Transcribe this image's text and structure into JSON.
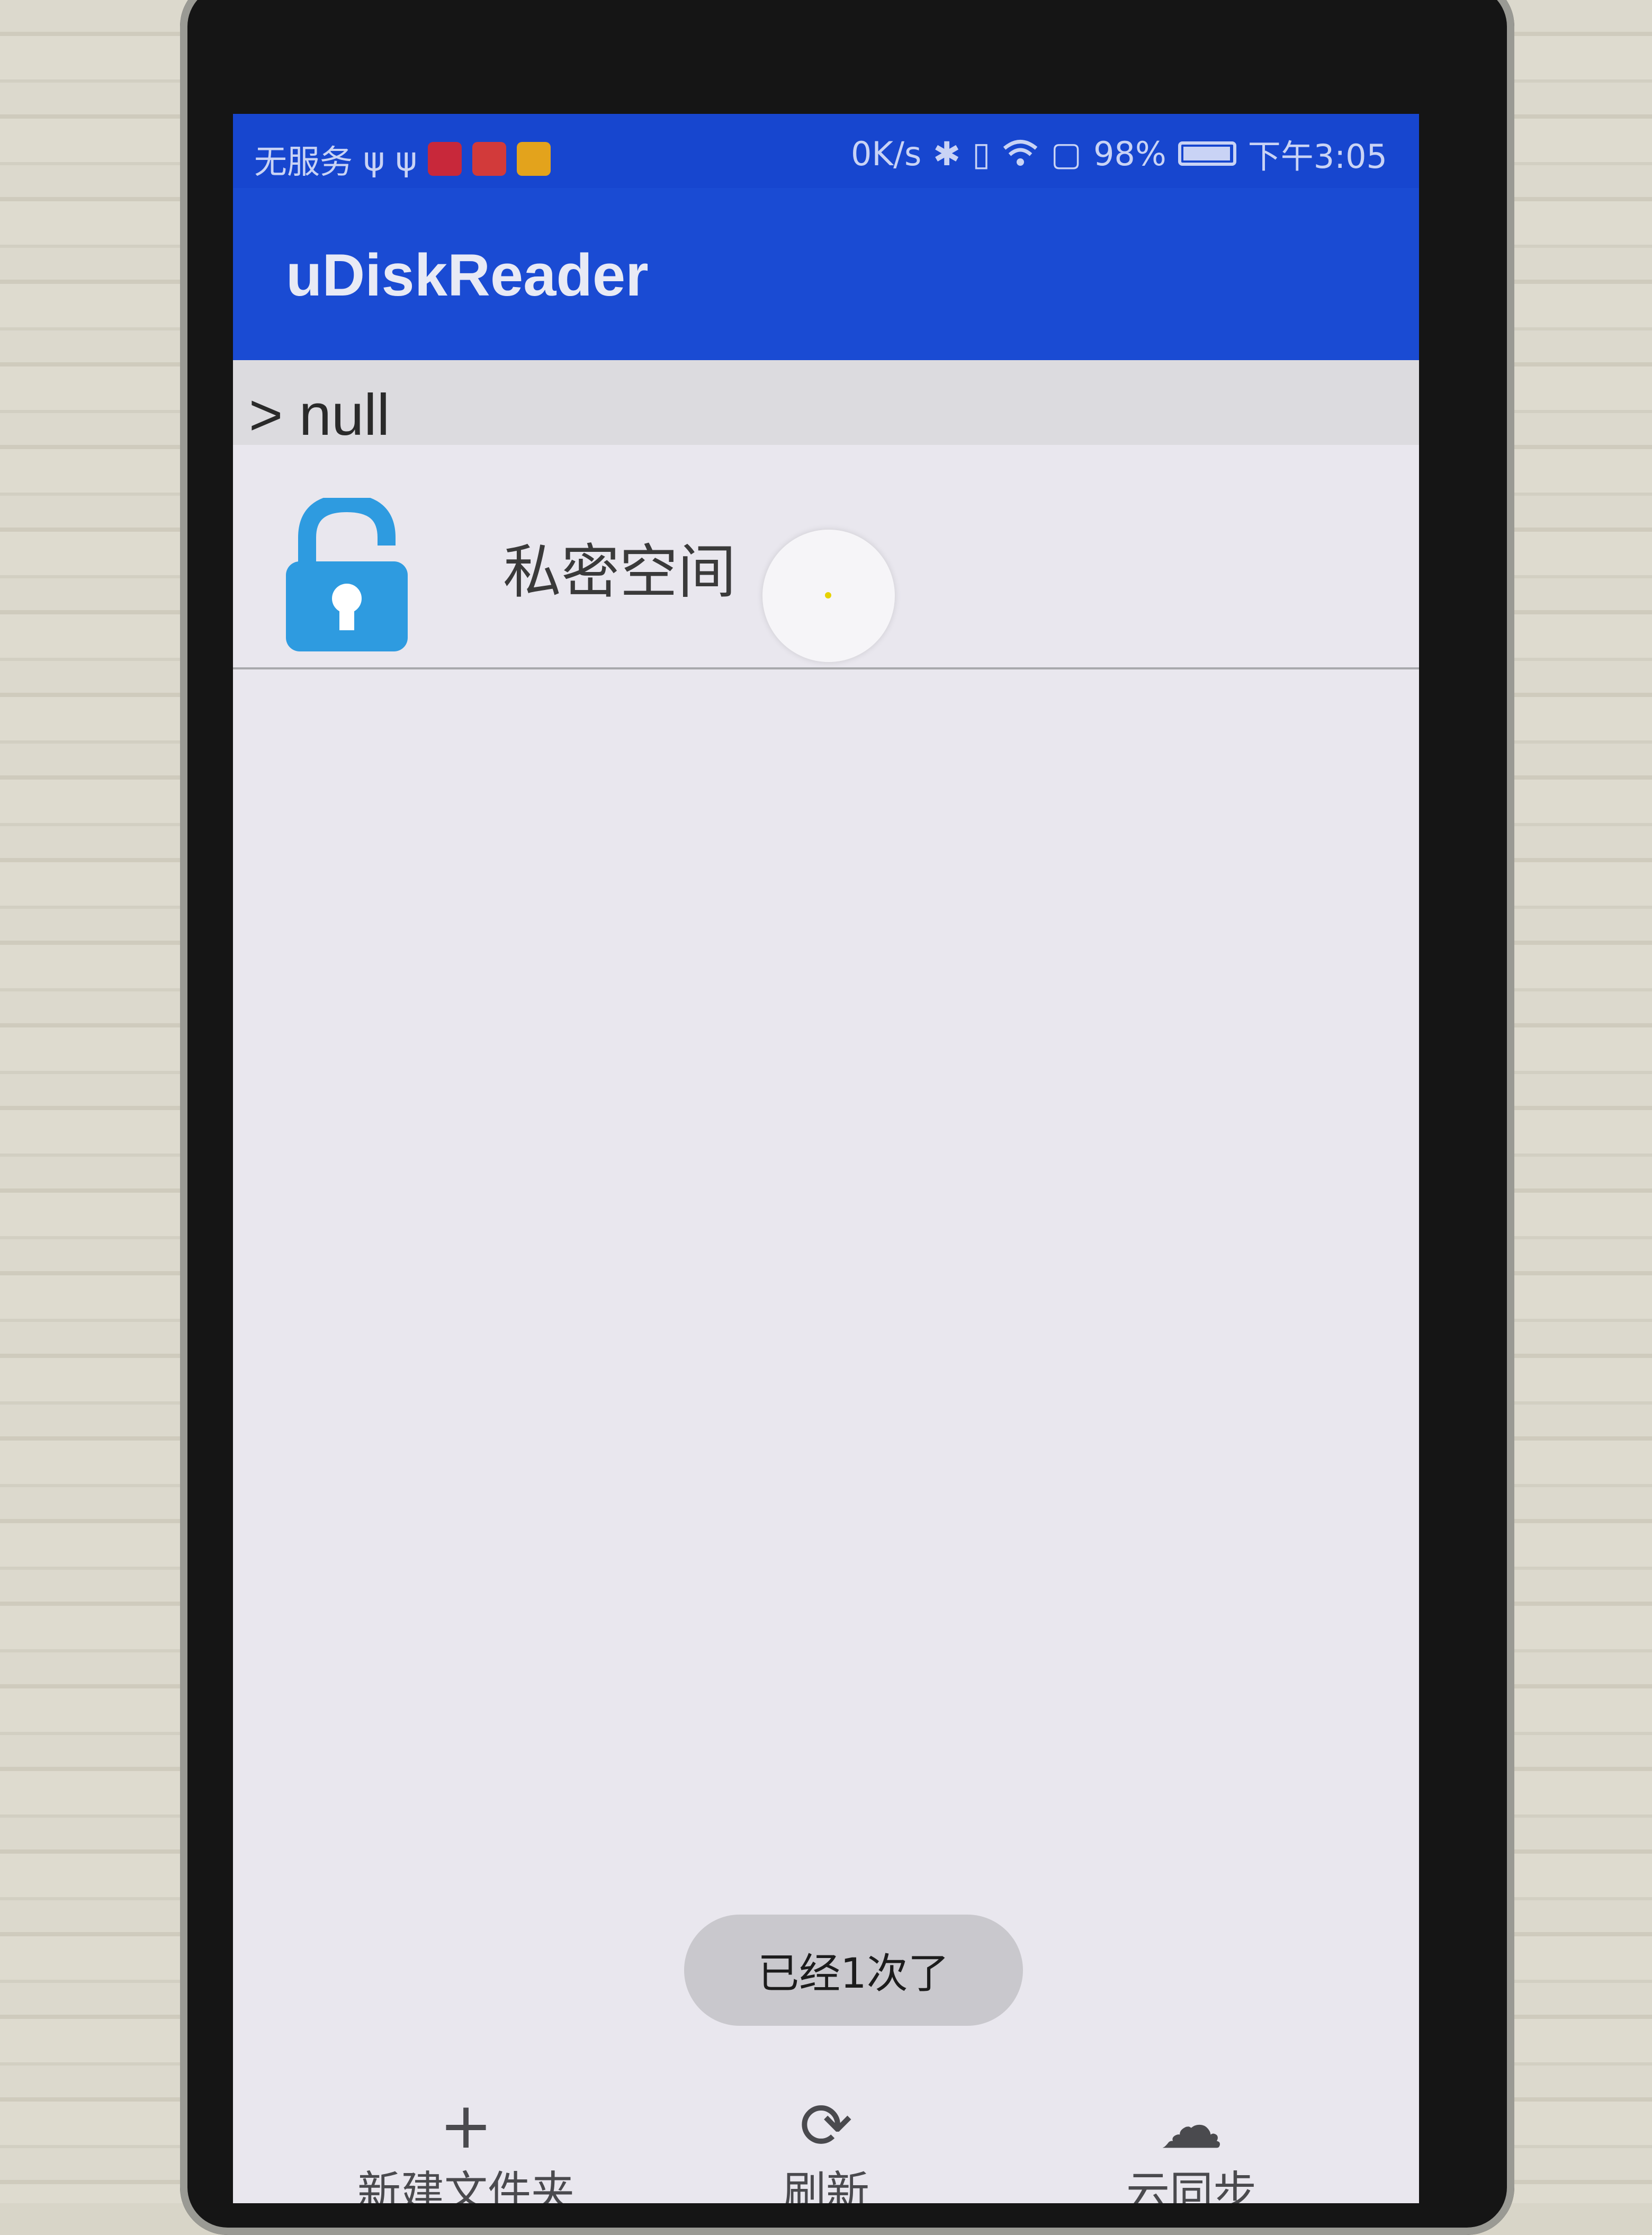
{
  "status_bar": {
    "carrier": "无服务",
    "speed": "0K/s",
    "battery_level": "98%",
    "battery_fraction": 0.98,
    "time": "下午3:05"
  },
  "app_bar": {
    "title": "uDiskReader"
  },
  "path_bar": {
    "path": "> null"
  },
  "file_list": {
    "items": [
      {
        "label": "私密空间",
        "icon": "unlocked-padlock-icon"
      }
    ]
  },
  "toast": {
    "message": "已经1次了"
  },
  "bottom_bar": {
    "buttons": [
      {
        "label": "新建文件夹",
        "icon": "plus-icon"
      },
      {
        "label": "刷新",
        "icon": "refresh-icon"
      },
      {
        "label": "云同步",
        "icon": "cloud-icon"
      }
    ]
  },
  "colors": {
    "app_bar": "#1a4bd3",
    "lock_icon": "#2e9be0",
    "screen_background": "#e9e7ee"
  }
}
